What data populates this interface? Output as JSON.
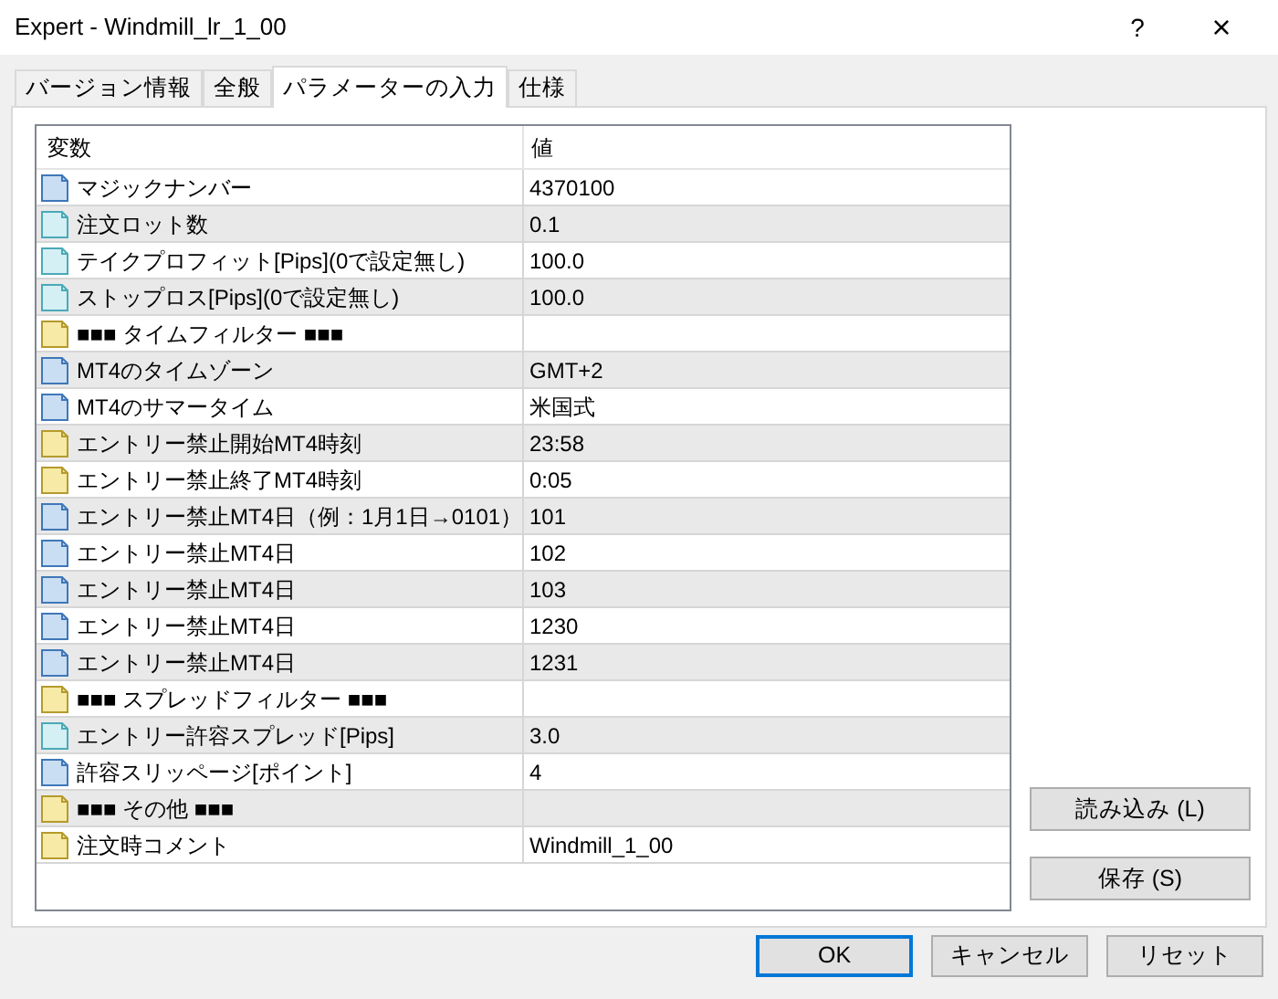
{
  "window": {
    "title": "Expert - Windmill_lr_1_00",
    "help": "?",
    "close": "×"
  },
  "tabs": [
    {
      "label": "バージョン情報",
      "selected": false
    },
    {
      "label": "全般",
      "selected": false
    },
    {
      "label": "パラメーターの入力",
      "selected": true
    },
    {
      "label": "仕様",
      "selected": false
    }
  ],
  "table": {
    "columns": [
      "変数",
      "値"
    ],
    "rows": [
      {
        "kind": "int",
        "name": "マジックナンバー",
        "value": "4370100"
      },
      {
        "kind": "double",
        "name": "注文ロット数",
        "value": "0.1"
      },
      {
        "kind": "double",
        "name": "テイクプロフィット[Pips](0で設定無し)",
        "value": "100.0"
      },
      {
        "kind": "double",
        "name": "ストップロス[Pips](0で設定無し)",
        "value": "100.0"
      },
      {
        "kind": "string",
        "name": "■■■ タイムフィルター ■■■"
      },
      {
        "kind": "int",
        "name": "MT4のタイムゾーン",
        "value": "GMT+2"
      },
      {
        "kind": "int",
        "name": "MT4のサマータイム",
        "value": "米国式"
      },
      {
        "kind": "string",
        "name": "エントリー禁止開始MT4時刻",
        "value": "23:58"
      },
      {
        "kind": "string",
        "name": "エントリー禁止終了MT4時刻",
        "value": "0:05"
      },
      {
        "kind": "int",
        "name": "エントリー禁止MT4日（例：1月1日→0101）",
        "value": "101"
      },
      {
        "kind": "int",
        "name": "エントリー禁止MT4日",
        "value": "102"
      },
      {
        "kind": "int",
        "name": "エントリー禁止MT4日",
        "value": "103"
      },
      {
        "kind": "int",
        "name": "エントリー禁止MT4日",
        "value": "1230"
      },
      {
        "kind": "int",
        "name": "エントリー禁止MT4日",
        "value": "1231"
      },
      {
        "kind": "string",
        "name": "■■■ スプレッドフィルター ■■■"
      },
      {
        "kind": "double",
        "name": "エントリー許容スプレッド[Pips]",
        "value": "3.0"
      },
      {
        "kind": "int",
        "name": "許容スリッページ[ポイント]",
        "value": "4"
      },
      {
        "kind": "string",
        "name": "■■■ その他 ■■■"
      },
      {
        "kind": "string",
        "name": "注文時コメント",
        "value": "Windmill_1_00"
      }
    ]
  },
  "side_buttons": [
    "読み込み (L)",
    "保存 (S)"
  ],
  "buttons": [
    {
      "label": "OK",
      "default": true
    },
    {
      "label": "キャンセル",
      "default": false
    },
    {
      "label": "リセット",
      "default": false
    }
  ]
}
